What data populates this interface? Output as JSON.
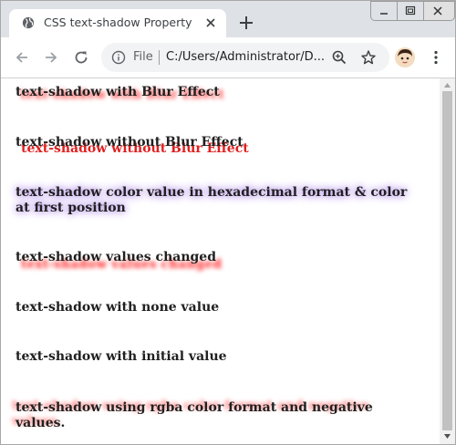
{
  "tab": {
    "title": "CSS text-shadow Property"
  },
  "omnibox": {
    "scheme": "File",
    "url": "C:/Users/Administrator/D..."
  },
  "page": {
    "lines": [
      "text-shadow with Blur Effect",
      "text-shadow without Blur Effect",
      "text-shadow color value in hexadecimal format & color at first position",
      "text-shadow values changed",
      "text-shadow with none value",
      "text-shadow with initial value",
      "text-shadow using rgba color format and negative values."
    ]
  },
  "colors": {
    "shadow_red": "#ff3b3b",
    "shadow_purple": "#7e3dd8",
    "tab_strip": "#dee1e6"
  },
  "icons": [
    "globe-icon",
    "close-icon",
    "plus-icon",
    "back-arrow-icon",
    "forward-arrow-icon",
    "reload-icon",
    "info-icon",
    "zoom-icon",
    "star-icon",
    "profile-avatar",
    "kebab-menu-icon"
  ]
}
